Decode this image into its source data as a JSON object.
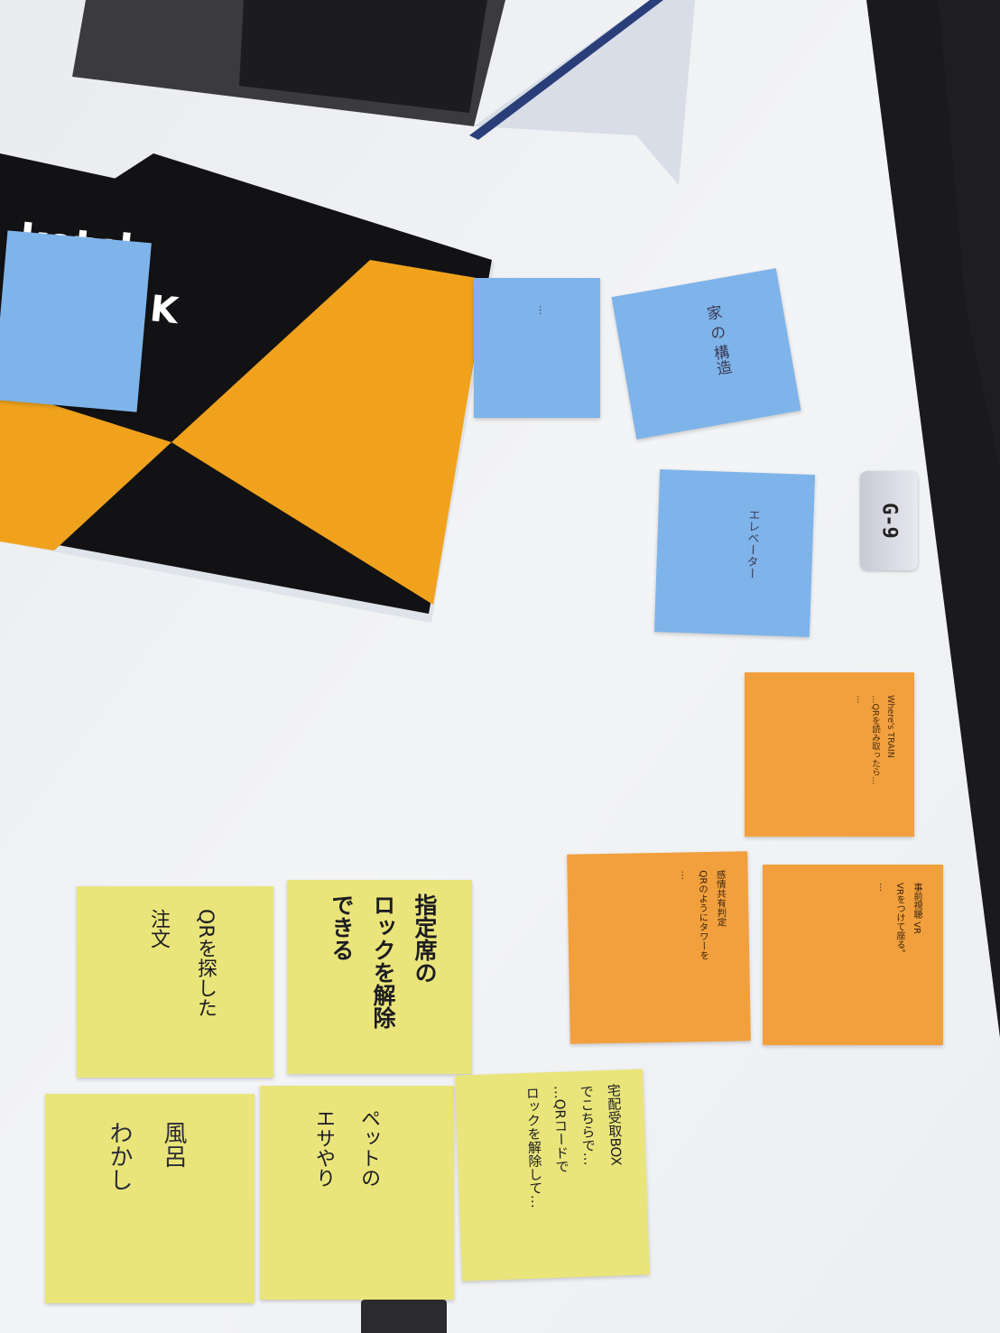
{
  "sketchbook": {
    "cover_text_1": "ketch",
    "cover_text_2": "K"
  },
  "location_badge": "G-9",
  "blue_notes": [
    {
      "line1": "…",
      "line2": "…"
    },
    {
      "line1": "家 の 構造"
    },
    {
      "line1": "エレベーター",
      "line2": "…"
    }
  ],
  "orange_notes": [
    {
      "text": "Where's TRAIN\n…QRを読み取ったら…\n…"
    },
    {
      "text": "感情共有判定\nQRのようにタワーを\n…"
    },
    {
      "text": "事前視聴 VR\nVRをつけて座る。\n…"
    }
  ],
  "yellow_notes": [
    {
      "text": "QRを探した\n注文"
    },
    {
      "text": "指定席の\nロックを解除\nできる"
    },
    {
      "text": "風呂\nわかし"
    },
    {
      "text": "ペットの\nエサやり"
    },
    {
      "text": "宅配受取BOX\nでこちらで…\n…QRコードで\nロックを解除して…"
    }
  ],
  "colors": {
    "table": "#f2f3f5",
    "blue": "#7fb4ea",
    "orange": "#f2a03d",
    "yellow": "#eae57a",
    "book_orange": "#f0a21d"
  }
}
